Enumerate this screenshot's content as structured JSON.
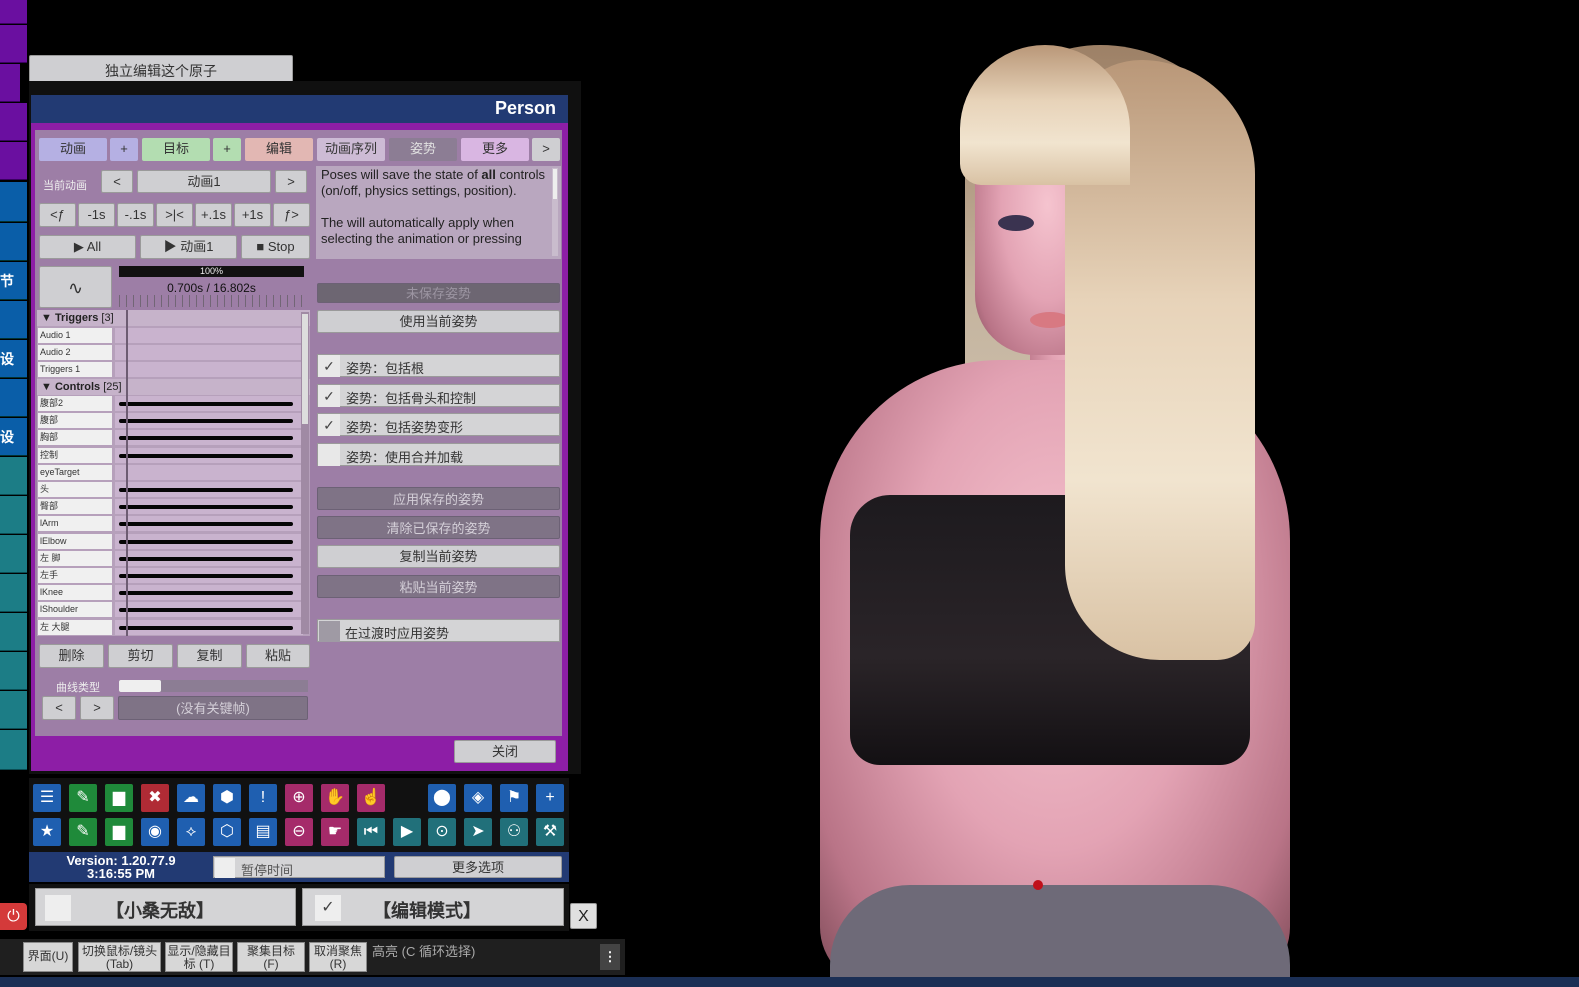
{
  "top_button": "独立编辑这个原子",
  "panel": {
    "title": "Person",
    "tabs": [
      "动画",
      "+",
      "目标",
      "+",
      "编辑",
      "动画序列",
      "姿势",
      "更多",
      ">"
    ],
    "current_anim_label": "当前动画",
    "current_anim_prev": "<",
    "current_anim_value": "动画1",
    "current_anim_next": ">",
    "step_buttons": [
      "<ƒ",
      "-1s",
      "-.1s",
      ">|<",
      "+.1s",
      "+1s",
      "ƒ>"
    ],
    "play_all": "▶ All",
    "play_anim": "▶ 动画1",
    "stop": "■ Stop",
    "curve_icon": "∿",
    "zoom_pct": "100%",
    "time_readout": "0.700s / 16.802s",
    "triggers_header": "▼ Triggers",
    "triggers_count": "[3]",
    "trigger_rows": [
      "Audio 1",
      "Audio 2",
      "Triggers 1"
    ],
    "controls_header": "▼ Controls",
    "controls_count": "[25]",
    "control_rows": [
      "腹部2",
      "腹部",
      "胸部",
      "控制",
      "eyeTarget",
      "头",
      "臀部",
      "lArm",
      "lElbow",
      "左 脚",
      "左手",
      "lKnee",
      "lShoulder",
      "左 大腿"
    ],
    "edit_buttons": [
      "删除",
      "剪切",
      "复制",
      "粘贴"
    ],
    "curve_type_label": "曲线类型",
    "key_prev": "<",
    "key_next": ">",
    "no_keyframe": "(没有关键帧)",
    "info_text": {
      "p1_a": "Poses will save the state of ",
      "p1_bold": "all",
      "p1_b": " controls (on/off, physics settings, position).",
      "p2": "The will automatically apply when selecting the animation or pressing"
    },
    "unsaved_pose": "未保存姿势",
    "use_current_pose": "使用当前姿势",
    "checks": [
      {
        "label": "姿势：包括根",
        "checked": "✓"
      },
      {
        "label": "姿势：包括骨头和控制",
        "checked": "✓"
      },
      {
        "label": "姿势：包括姿势变形",
        "checked": "✓"
      },
      {
        "label": "姿势：使用合并加载",
        "checked": ""
      }
    ],
    "apply_saved_pose": "应用保存的姿势",
    "clear_saved_pose": "清除已保存的姿势",
    "copy_pose": "复制当前姿势",
    "paste_pose": "粘贴当前姿势",
    "apply_on_transition": "在过渡时应用姿势",
    "close": "关闭"
  },
  "toolbar_icons_row1": [
    "menu-icon",
    "save-scene-icon",
    "folder-icon",
    "delete-scene-icon",
    "cloud-download-icon",
    "package-icon",
    "alert-icon",
    "add-person-icon",
    "hand-icon",
    "touch-icon",
    "person-icon",
    "unity-icon",
    "flag-icon",
    "plus-icon"
  ],
  "toolbar_icons_row2": [
    "star-icon",
    "save-icon",
    "open-folder-icon",
    "camera-icon",
    "network-icon",
    "open-box-icon",
    "document-icon",
    "remove-person-icon",
    "pointer-hand-icon",
    "skip-back-icon",
    "play-icon",
    "target-icon",
    "cursor-icon",
    "people-icon",
    "tools-icon"
  ],
  "toolbar_glyphs_row1": [
    "☰",
    "✎",
    "▆",
    "✖",
    "☁",
    "⬢",
    "!",
    "⊕",
    "✋",
    "☝",
    "⬤",
    "◈",
    "⚑",
    "+"
  ],
  "toolbar_glyphs_row2": [
    "★",
    "✎",
    "▆",
    "◉",
    "⟡",
    "⬡",
    "▤",
    "⊖",
    "☛",
    "⏮",
    "▶",
    "⊙",
    "➤",
    "⚇",
    "⚒"
  ],
  "version": "Version: 1.20.77.9",
  "clock": "3:16:55 PM",
  "pause_time": "暂停时间",
  "more_options": "更多选项",
  "god_mode": {
    "label": "【小桑无敌】",
    "checked": ""
  },
  "edit_mode": {
    "label": "【编辑模式】",
    "checked": "✓"
  },
  "close_x": "X",
  "bottom_bar": {
    "items": [
      {
        "l1": "界面(U)",
        "l2": ""
      },
      {
        "l1": "切换鼠标/镜头",
        "l2": "(Tab)"
      },
      {
        "l1": "显示/隐藏目",
        "l2": "标 (T)"
      },
      {
        "l1": "聚集目标",
        "l2": "(F)"
      },
      {
        "l1": "取消聚焦",
        "l2": "(R)"
      }
    ],
    "highlight": "高亮 (C 循环选择)",
    "more": "⋮"
  },
  "left_strip": [
    "",
    "节",
    "设",
    "设"
  ],
  "colors": {
    "panel_purple": "#8d1ea6",
    "title_blue": "#223a73",
    "panel_body": "#9d7ea6"
  }
}
